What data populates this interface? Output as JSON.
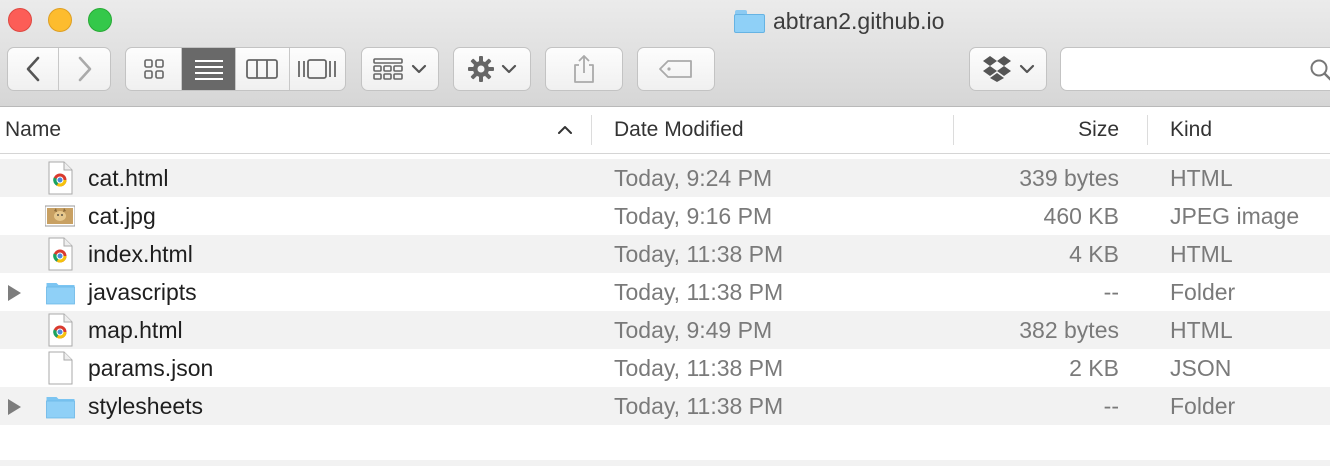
{
  "window": {
    "title": "abtran2.github.io"
  },
  "toolbar": {
    "back_icon": "chevron-left-icon",
    "forward_icon": "chevron-right-icon",
    "view_modes": [
      "icon-view-icon",
      "list-view-icon",
      "column-view-icon",
      "cover-flow-icon"
    ],
    "active_view": "list",
    "arrange_icon": "arrange-grid-icon",
    "action_icon": "gear-icon",
    "share_icon": "share-icon",
    "tag_icon": "tag-icon",
    "dropbox_icon": "dropbox-icon",
    "search_placeholder": ""
  },
  "columns": {
    "name": "Name",
    "date": "Date Modified",
    "size": "Size",
    "kind": "Kind"
  },
  "files": [
    {
      "name": "cat.html",
      "date": "Today, 9:24 PM",
      "size": "339 bytes",
      "kind": "HTML",
      "icon": "chrome-html-icon",
      "folder": false
    },
    {
      "name": "cat.jpg",
      "date": "Today, 9:16 PM",
      "size": "460 KB",
      "kind": "JPEG image",
      "icon": "image-thumbnail-icon",
      "folder": false
    },
    {
      "name": "index.html",
      "date": "Today, 11:38 PM",
      "size": "4 KB",
      "kind": "HTML",
      "icon": "chrome-html-icon",
      "folder": false
    },
    {
      "name": "javascripts",
      "date": "Today, 11:38 PM",
      "size": "--",
      "kind": "Folder",
      "icon": "folder-icon",
      "folder": true
    },
    {
      "name": "map.html",
      "date": "Today, 9:49 PM",
      "size": "382 bytes",
      "kind": "HTML",
      "icon": "chrome-html-icon",
      "folder": false
    },
    {
      "name": "params.json",
      "date": "Today, 11:38 PM",
      "size": "2 KB",
      "kind": "JSON",
      "icon": "blank-document-icon",
      "folder": false
    },
    {
      "name": "stylesheets",
      "date": "Today, 11:38 PM",
      "size": "--",
      "kind": "Folder",
      "icon": "folder-icon",
      "folder": true
    }
  ]
}
